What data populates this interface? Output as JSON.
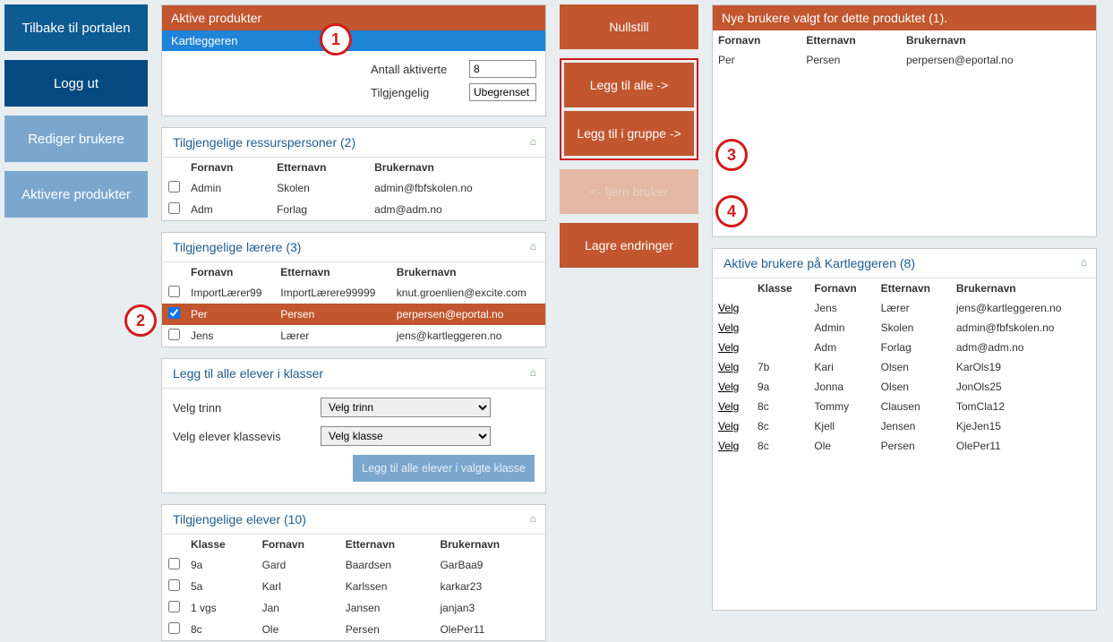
{
  "sidebar": {
    "back": "Tilbake til portalen",
    "logout": "Logg ut",
    "editUsers": "Rediger brukere",
    "activateProducts": "Aktivere produkter"
  },
  "products": {
    "header": "Aktive produkter",
    "selected": "Kartleggeren",
    "countLabel": "Antall aktiverte",
    "countValue": "8",
    "availLabel": "Tilgjengelig",
    "availValue": "Ubegrenset"
  },
  "resources": {
    "header": "Tilgjengelige ressurspersoner (2)",
    "cols": {
      "first": "Fornavn",
      "last": "Etternavn",
      "user": "Brukernavn"
    },
    "rows": [
      {
        "first": "Admin",
        "last": "Skolen",
        "user": "admin@fbfskolen.no"
      },
      {
        "first": "Adm",
        "last": "Forlag",
        "user": "adm@adm.no"
      }
    ]
  },
  "teachers": {
    "header": "Tilgjengelige lærere (3)",
    "cols": {
      "first": "Fornavn",
      "last": "Etternavn",
      "user": "Brukernavn"
    },
    "rows": [
      {
        "first": "ImportLærer99",
        "last": "ImportLærere99999",
        "user": "knut.groenlien@excite.com",
        "checked": false,
        "selected": false
      },
      {
        "first": "Per",
        "last": "Persen",
        "user": "perpersen@eportal.no",
        "checked": true,
        "selected": true
      },
      {
        "first": "Jens",
        "last": "Lærer",
        "user": "jens@kartleggeren.no",
        "checked": false,
        "selected": false
      }
    ]
  },
  "classes": {
    "header": "Legg til alle elever i klasser",
    "levelLabel": "Velg trinn",
    "levelPlaceholder": "Velg trinn",
    "classLabel": "Velg elever klassevis",
    "classPlaceholder": "Velg klasse",
    "addBtn": "Legg til alle elever i valgte klasse"
  },
  "students": {
    "header": "Tilgjengelige elever (10)",
    "cols": {
      "klass": "Klasse",
      "first": "Fornavn",
      "last": "Etternavn",
      "user": "Brukernavn"
    },
    "rows": [
      {
        "klass": "9a",
        "first": "Gard",
        "last": "Baardsen",
        "user": "GarBaa9"
      },
      {
        "klass": "5a",
        "first": "Karl",
        "last": "Karlssen",
        "user": "karkar23"
      },
      {
        "klass": "1 vgs",
        "first": "Jan",
        "last": "Jansen",
        "user": "janjan3"
      },
      {
        "klass": "8c",
        "first": "Ole",
        "last": "Persen",
        "user": "OlePer11"
      }
    ]
  },
  "mid": {
    "reset": "Nullstill",
    "addAll": "Legg til alle ->",
    "addGroup": "Legg til i gruppe ->",
    "remove": "<- fjern bruker",
    "save": "Lagre endringer"
  },
  "newUsers": {
    "header": "Nye brukere valgt for dette produktet (1).",
    "cols": {
      "first": "Fornavn",
      "last": "Etternavn",
      "user": "Brukernavn"
    },
    "rows": [
      {
        "first": "Per",
        "last": "Persen",
        "user": "perpersen@eportal.no"
      }
    ]
  },
  "active": {
    "header": "Aktive brukere på Kartleggeren (8)",
    "cols": {
      "select": "",
      "klass": "Klasse",
      "first": "Fornavn",
      "last": "Etternavn",
      "user": "Brukernavn"
    },
    "selectLabel": "Velg",
    "rows": [
      {
        "klass": "",
        "first": "Jens",
        "last": "Lærer",
        "user": "jens@kartleggeren.no"
      },
      {
        "klass": "",
        "first": "Admin",
        "last": "Skolen",
        "user": "admin@fbfskolen.no"
      },
      {
        "klass": "",
        "first": "Adm",
        "last": "Forlag",
        "user": "adm@adm.no"
      },
      {
        "klass": "7b",
        "first": "Kari",
        "last": "Olsen",
        "user": "KarOls19"
      },
      {
        "klass": "9a",
        "first": "Jonna",
        "last": "Olsen",
        "user": "JonOls25"
      },
      {
        "klass": "8c",
        "first": "Tommy",
        "last": "Clausen",
        "user": "TomCla12"
      },
      {
        "klass": "8c",
        "first": "Kjell",
        "last": "Jensen",
        "user": "KjeJen15"
      },
      {
        "klass": "8c",
        "first": "Ole",
        "last": "Persen",
        "user": "OlePer11"
      }
    ]
  },
  "callouts": {
    "c1": "1",
    "c2": "2",
    "c3": "3",
    "c4": "4"
  }
}
